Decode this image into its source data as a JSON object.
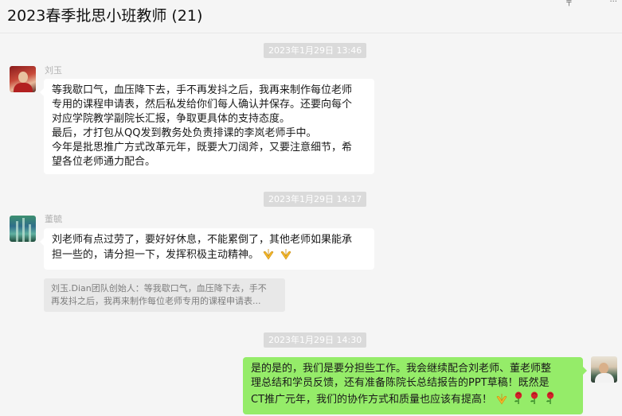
{
  "window": {
    "title": "2023春季批思小班教师 (21)",
    "icons": [
      "pin-icon",
      "more-icon"
    ]
  },
  "messages": [
    {
      "type": "timestamp",
      "text": "2023年1月29日 13:46"
    },
    {
      "type": "message",
      "sender": "刘玉",
      "side": "left",
      "lines": [
        "等我歇口气，血压降下去，手不再发抖之后，我再来制作每位老师",
        "专用的课程申请表，然后私发给你们每人确认并保存。还要向每个",
        "对应学院教学副院长汇报，争取更具体的支持态度。",
        "最后，才打包从QQ发到教务处负责排课的李岚老师手中。",
        "今年是批思推广方式改革元年，既要大刀阔斧，又要注意细节，希",
        "望各位老师通力配合。"
      ]
    },
    {
      "type": "timestamp",
      "text": "2023年1月29日 14:17"
    },
    {
      "type": "message",
      "sender": "董毓",
      "side": "left",
      "lines": [
        "刘老师有点过劳了，要好好休息，不能累倒了，其他老师如果能承",
        "担一些的，请分担一下，发挥积极主动精神。"
      ],
      "emojis": [
        "praying-hands-icon",
        "praying-hands-icon"
      ],
      "quote_lines": [
        "刘玉.Dian团队创始人：等我歇口气，血压降下去，手不",
        "再发抖之后，我再来制作每位老师专用的课程申请表..."
      ]
    },
    {
      "type": "timestamp",
      "text": "2023年1月29日 14:30"
    },
    {
      "type": "message",
      "sender": "",
      "side": "right",
      "lines": [
        "是的是的，我们是要分担些工作。我会继续配合刘老师、董老师整",
        "理总结和学员反馈，还有准备陈院长总结报告的PPT草稿！既然是",
        "CT推广元年，我们的协作方式和质量也应该有提高！"
      ],
      "emojis": [
        "praying-hands-icon",
        "rose-icon",
        "rose-icon",
        "rose-icon"
      ]
    }
  ],
  "colors": {
    "background": "#f5f5f5",
    "bubble_left": "#ffffff",
    "bubble_right": "#95ec69",
    "timestamp_bg": "#dadada",
    "quote_bg": "#e8e8e8"
  }
}
